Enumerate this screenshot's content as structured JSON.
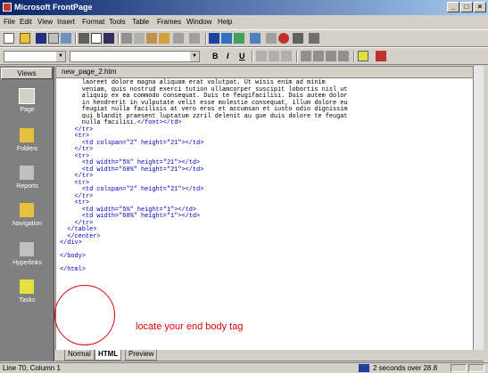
{
  "window": {
    "title": "Microsoft FrontPage",
    "buttons": [
      "_",
      "□",
      "×"
    ]
  },
  "menubar": {
    "items": [
      "File",
      "Edit",
      "View",
      "Insert",
      "Format",
      "Tools",
      "Table",
      "Frames",
      "Window",
      "Help"
    ]
  },
  "format_toolbar": {
    "bold": "B",
    "italic": "I",
    "underline": "U"
  },
  "views": {
    "header": "Views",
    "items": [
      "Page",
      "Folders",
      "Reports",
      "Navigation",
      "Hyperlinks",
      "Tasks"
    ]
  },
  "document": {
    "tab_name": "new_page_2.htm"
  },
  "code_lines": [
    "      laoreet dolore magna aliquam erat volutpat. Ut wisis enim ad minim",
    "      veniam, quis nostrud exerci tution ullamcorper suscipit lobortis nisl ut",
    "      aliquip ex ea commodo consequat. Duis te feugifacilisi. Duis autem dolor",
    "      in hendrerit in vulputate velit esse molestie consequat, illum dolore eu",
    "      feugiat nulla facilisis at vero eros et accumsan et iusto odio dignissim",
    "      qui blandit praesent luptatum zzril delenit au gue duis dolore te feugat",
    "      nulla facilisi.</font></td>",
    "    </tr>",
    "    <tr>",
    "      <td colspan=\"2\" height=\"21\"></td>",
    "    </tr>",
    "    <tr>",
    "      <td width=\"5%\" height=\"21\"></td>",
    "      <td width=\"60%\" height=\"21\"></td>",
    "    </tr>",
    "    <tr>",
    "      <td colspan=\"2\" height=\"21\"></td>",
    "    </tr>",
    "    <tr>",
    "      <td width=\"5%\" height=\"1\"></td>",
    "      <td width=\"60%\" height=\"1\"></td>",
    "    </tr>",
    "  </table>",
    "  </center>",
    "</div>",
    "",
    "</body>",
    "",
    "</html>"
  ],
  "annotation": "locate your end body tag",
  "bottom_tabs": [
    "Normal",
    "HTML",
    "Preview"
  ],
  "status": {
    "position": "Line 70, Column 1",
    "download": "2 seconds over 28.8"
  }
}
